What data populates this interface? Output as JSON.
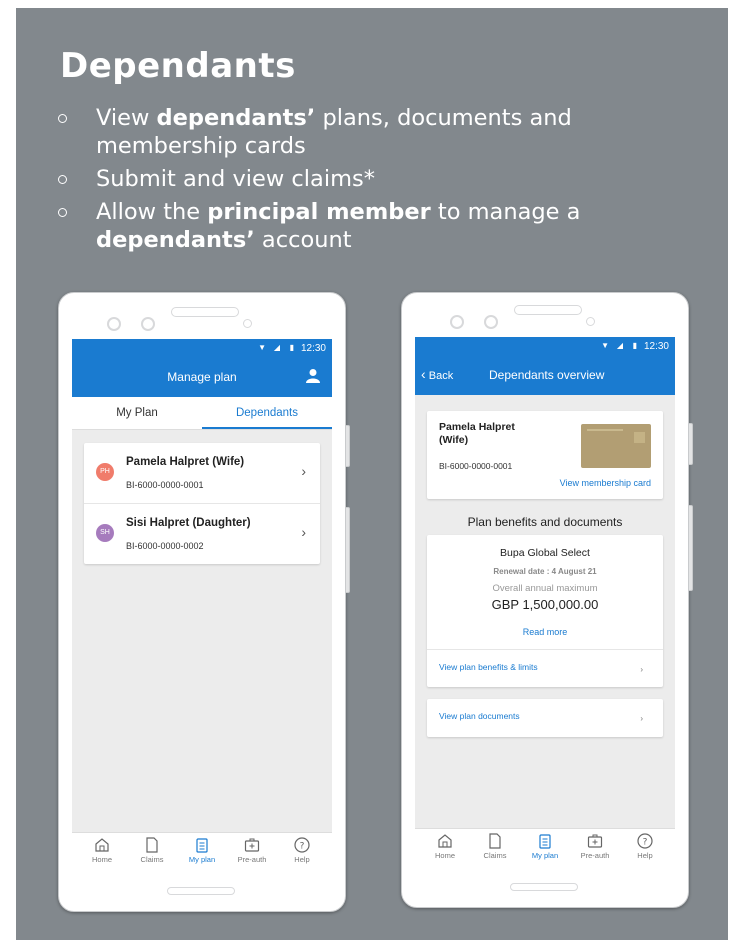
{
  "slide": {
    "title": "Dependants",
    "bullets": {
      "b1": {
        "pre": "View ",
        "bold": "dependants’",
        "post": " plans, documents and membership cards"
      },
      "b2": {
        "text": "Submit and view claims*"
      },
      "b3": {
        "pre": "Allow the ",
        "bold": "principal member",
        "mid": " to manage a ",
        "bold2": "dependants’",
        "post": " account"
      }
    }
  },
  "colors": {
    "brand": "#1a7bd0",
    "background": "#82888d"
  },
  "phone1": {
    "status_time": "12:30",
    "title": "Manage plan",
    "tabs": {
      "my_plan": "My Plan",
      "dependants": "Dependants"
    },
    "dependants": [
      {
        "initials": "PH",
        "name": "Pamela Halpret (Wife)",
        "id": "BI-6000-0000-0001",
        "color": "#f07c6b"
      },
      {
        "initials": "SH",
        "name": "Sisi Halpret (Daughter)",
        "id": "BI-6000-0000-0002",
        "color": "#a67bbd"
      }
    ],
    "nav": {
      "home": "Home",
      "claims": "Claims",
      "my_plan": "My plan",
      "pre_auth": "Pre-auth",
      "help": "Help"
    }
  },
  "phone2": {
    "status_time": "12:30",
    "back": "Back",
    "title": "Dependants overview",
    "member": {
      "name": "Pamela Halpret",
      "relation": "(Wife)",
      "id": "BI-6000-0000-0001",
      "card_link": "View membership card"
    },
    "section_title": "Plan benefits and documents",
    "plan": {
      "name": "Bupa Global Select",
      "renewal": "Renewal date : 4 August 21",
      "overall_label": "Overall annual maximum",
      "amount": "GBP 1,500,000.00",
      "read_more": "Read more",
      "benefits_link": "View plan benefits & limits",
      "documents_link": "View plan documents"
    },
    "nav": {
      "home": "Home",
      "claims": "Claims",
      "my_plan": "My plan",
      "pre_auth": "Pre-auth",
      "help": "Help"
    }
  }
}
